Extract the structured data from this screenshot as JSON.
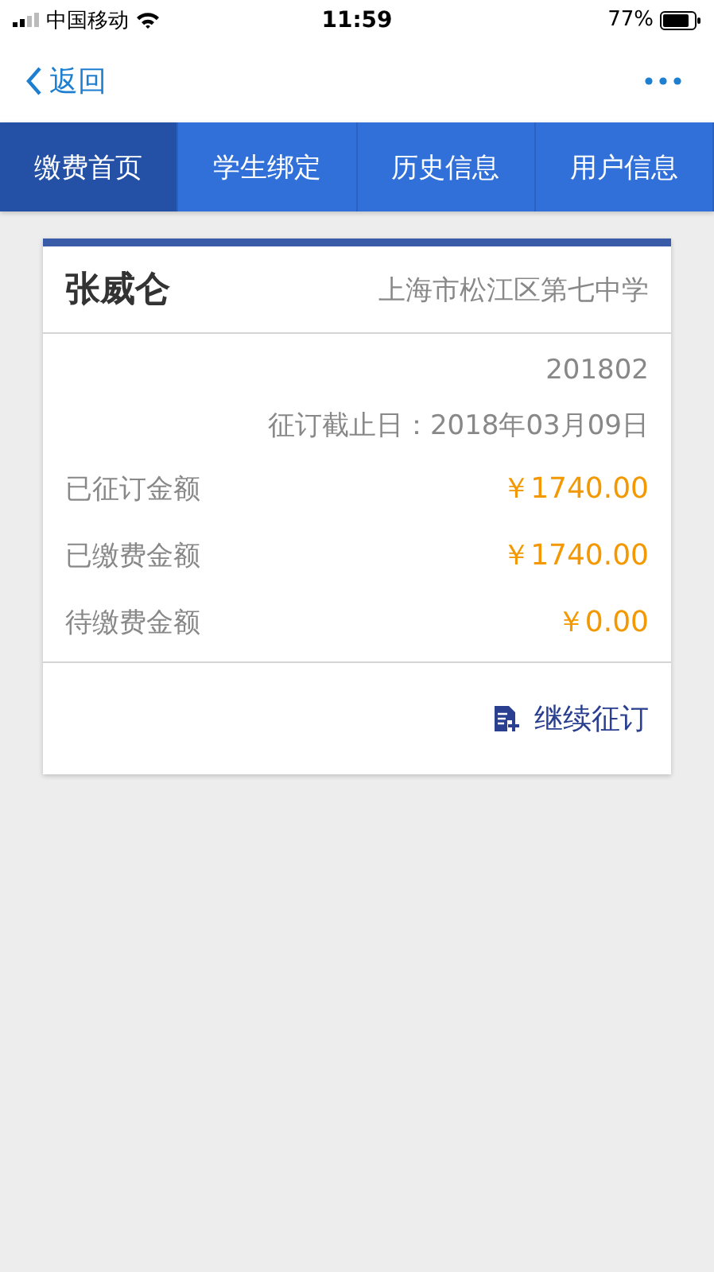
{
  "status_bar": {
    "carrier": "中国移动",
    "time": "11:59",
    "battery": "77%"
  },
  "nav_bar": {
    "back": "返回"
  },
  "tabs": [
    {
      "label": "缴费首页",
      "selected": true
    },
    {
      "label": "学生绑定",
      "selected": false
    },
    {
      "label": "历史信息",
      "selected": false
    },
    {
      "label": "用户信息",
      "selected": false
    }
  ],
  "card": {
    "student": "张威仑",
    "school": "上海市松江区第七中学",
    "period": "201802",
    "deadline": "征订截止日：2018年03月09日",
    "rows": [
      {
        "label": "已征订金额",
        "amount": "￥1740.00"
      },
      {
        "label": "已缴费金额",
        "amount": "￥1740.00"
      },
      {
        "label": "待缴费金额",
        "amount": "￥0.00"
      }
    ],
    "action": "继续征订"
  }
}
